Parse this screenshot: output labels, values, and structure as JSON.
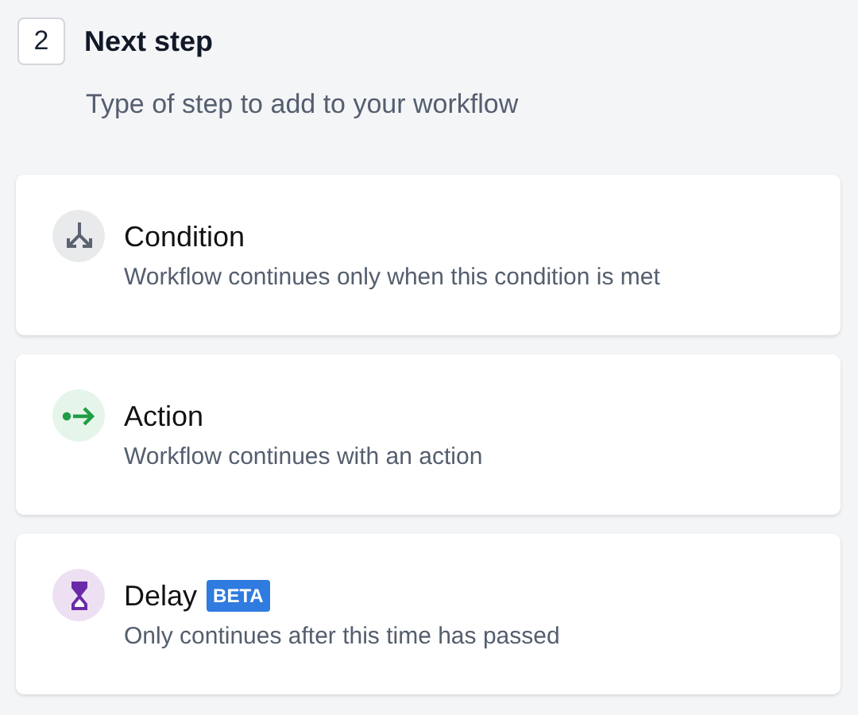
{
  "step": {
    "number": "2",
    "title": "Next step",
    "subtitle": "Type of step to add to your workflow"
  },
  "options": [
    {
      "kind": "condition",
      "title": "Condition",
      "description": "Workflow continues only when this condition is met"
    },
    {
      "kind": "action",
      "title": "Action",
      "description": "Workflow continues with an action"
    },
    {
      "kind": "delay",
      "title": "Delay",
      "badge": "BETA",
      "description": "Only continues after this time has passed"
    }
  ]
}
